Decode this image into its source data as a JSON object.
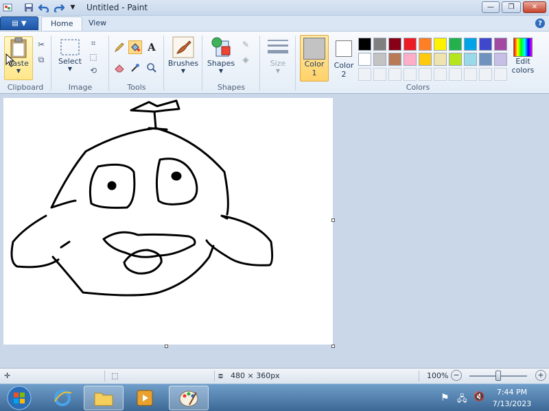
{
  "window": {
    "title": "Untitled - Paint",
    "quick_access": [
      "paint-app-icon",
      "save-icon",
      "undo-icon",
      "redo-icon",
      "customize-icon"
    ]
  },
  "tabs": [
    {
      "label": "Home",
      "active": true
    },
    {
      "label": "View",
      "active": false
    }
  ],
  "ribbon": {
    "clipboard": {
      "paste_label": "Paste",
      "group_label": "Clipboard"
    },
    "image": {
      "select_label": "Select",
      "group_label": "Image"
    },
    "tools": {
      "group_label": "Tools"
    },
    "brushes": {
      "label": "Brushes"
    },
    "shapes": {
      "label": "Shapes",
      "group_label": "Shapes"
    },
    "size": {
      "label": "Size"
    },
    "colors": {
      "color1_label": "Color",
      "color1_num": "1",
      "color1_value": "#c3c3c3",
      "color2_label": "Color",
      "color2_num": "2",
      "color2_value": "#ffffff",
      "edit_label_1": "Edit",
      "edit_label_2": "colors",
      "group_label": "Colors",
      "row1": [
        "#000000",
        "#7f7f7f",
        "#880015",
        "#ed1c24",
        "#ff7f27",
        "#fff200",
        "#22b14c",
        "#00a2e8",
        "#3f48cc",
        "#a349a4"
      ],
      "row2": [
        "#ffffff",
        "#c3c3c3",
        "#b97a57",
        "#ffaec9",
        "#ffc90e",
        "#efe4b0",
        "#b5e61d",
        "#99d9ea",
        "#7092be",
        "#c8bfe7"
      ]
    }
  },
  "status": {
    "canvas_size": "480 × 360px",
    "zoom": "100%",
    "zoom_level": 1.0
  },
  "taskbar": {
    "time": "7:44 PM",
    "date": "7/13/2023"
  }
}
